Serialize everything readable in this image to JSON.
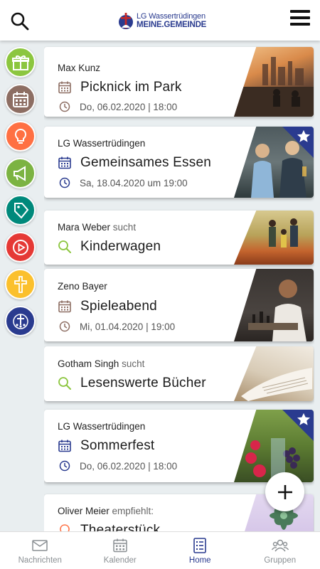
{
  "header": {
    "logo_line1": "LG Wassertrüdingen",
    "logo_line2": "MEINE.GEMEINDE"
  },
  "side_rail": [
    {
      "name": "gift",
      "color": "#8cc63f"
    },
    {
      "name": "calendar",
      "color": "#8d6e63"
    },
    {
      "name": "lightbulb",
      "color": "#ff7043"
    },
    {
      "name": "megaphone",
      "color": "#7cb342"
    },
    {
      "name": "tag",
      "color": "#00897b"
    },
    {
      "name": "youtube",
      "color": "#e53935"
    },
    {
      "name": "cross",
      "color": "#fbc02d"
    },
    {
      "name": "community",
      "color": "#2a3b8f"
    }
  ],
  "cards": [
    {
      "author": "Max Kunz",
      "verb": "",
      "title": "Picknick im Park",
      "title_icon": "calendar-icon",
      "date": "Do, 06.02.2020 | 18:00",
      "date_icon": "clock-icon",
      "accent": "#8d6e63",
      "starred": false
    },
    {
      "author": "LG Wassertrüdingen",
      "verb": "",
      "title": "Gemeinsames Essen",
      "title_icon": "calendar-icon",
      "date": "Sa, 18.04.2020 um 19:00",
      "date_icon": "clock-icon",
      "accent": "#2a3b8f",
      "starred": true
    },
    {
      "author": "Mara Weber",
      "verb": "sucht",
      "title": "Kinderwagen",
      "title_icon": "search-icon",
      "date": "",
      "accent": "#8cc63f",
      "starred": false
    },
    {
      "author": "Zeno Bayer",
      "verb": "",
      "title": "Spieleabend",
      "title_icon": "calendar-icon",
      "date": "Mi, 01.04.2020 | 19:00",
      "date_icon": "clock-icon",
      "accent": "#8d6e63",
      "starred": false
    },
    {
      "author": "Gotham Singh",
      "verb": "sucht",
      "title": "Lesenswerte Bücher",
      "title_icon": "search-icon",
      "date": "",
      "accent": "#8cc63f",
      "starred": false
    },
    {
      "author": "LG Wassertrüdingen",
      "verb": "",
      "title": "Sommerfest",
      "title_icon": "calendar-icon",
      "date": "Do, 06.02.2020 | 18:00",
      "date_icon": "clock-icon",
      "accent": "#2a3b8f",
      "starred": true
    },
    {
      "author": "Oliver Meier",
      "verb": "empfiehlt:",
      "title": "Theaterstück",
      "title_icon": "lightbulb-icon",
      "date": "",
      "accent": "#ff7043",
      "starred": false
    }
  ],
  "bottom_nav": [
    {
      "label": "Nachrichten",
      "icon": "mail-icon",
      "active": false
    },
    {
      "label": "Kalender",
      "icon": "calendar-icon",
      "active": false
    },
    {
      "label": "Home",
      "icon": "list-icon",
      "active": true
    },
    {
      "label": "Gruppen",
      "icon": "group-icon",
      "active": false
    }
  ],
  "colors": {
    "brand": "#2a3b8f",
    "nav_inactive": "#8a8f93"
  }
}
